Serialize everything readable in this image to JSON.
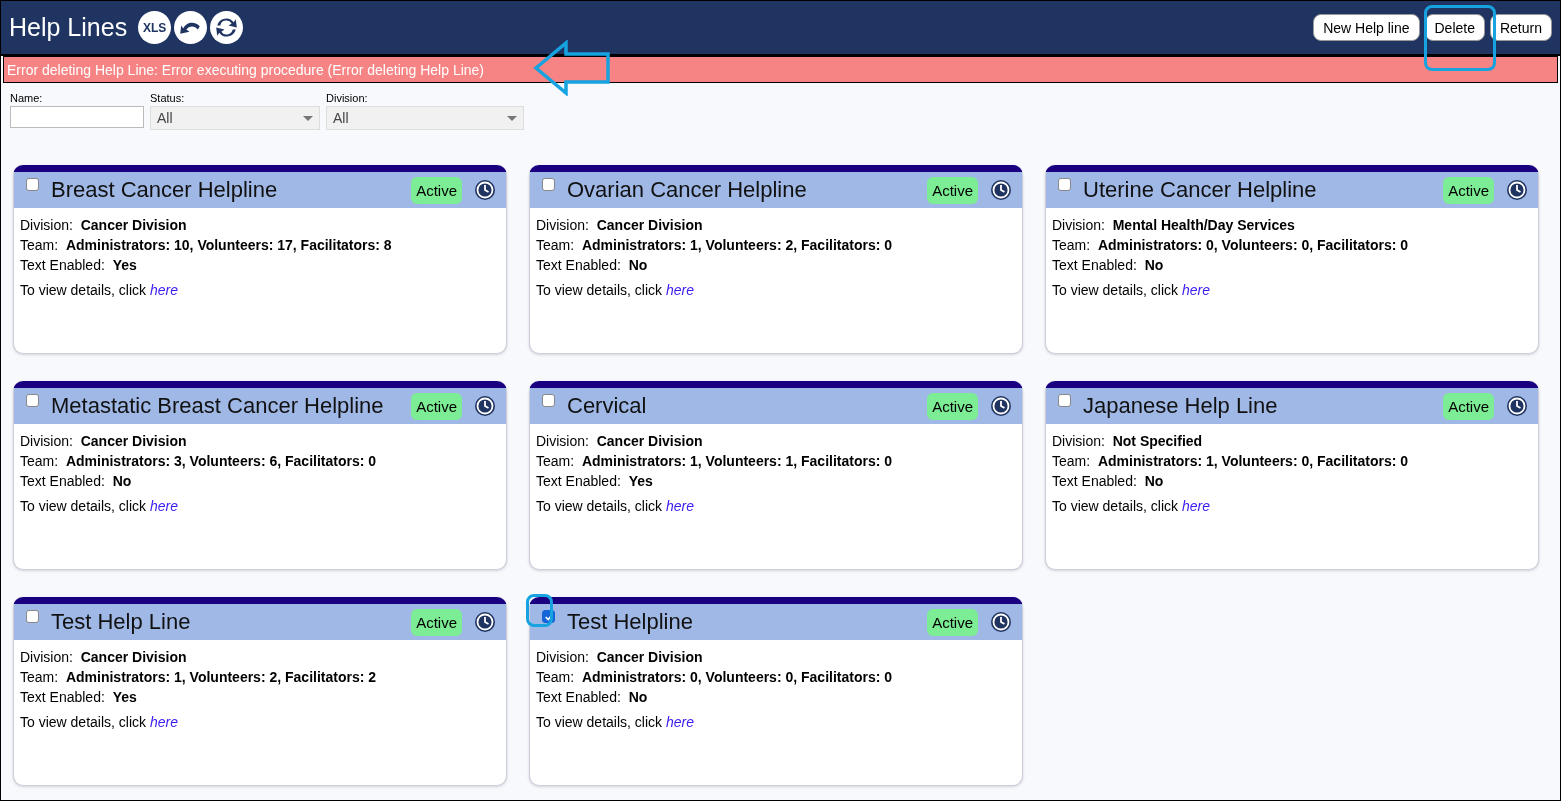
{
  "header": {
    "title": "Help Lines",
    "xls_label": "XLS",
    "buttons": [
      "New Help line",
      "Delete",
      "Return"
    ]
  },
  "error": "Error deleting Help Line: Error executing procedure (Error deleting Help Line)",
  "filters": [
    {
      "kind": "text",
      "label": "Name:"
    },
    {
      "kind": "select",
      "label": "Status:",
      "value": "All"
    },
    {
      "kind": "select",
      "label": "Division:",
      "value": "All"
    }
  ],
  "cards": [
    {
      "title": "Breast Cancer Helpline",
      "checked": false,
      "status": "Active",
      "division_label": "Division:",
      "division": "Cancer Division",
      "team_label": "Team:",
      "team": "Administrators: 10, Volunteers: 17, Facilitators: 8",
      "text_label": "Text Enabled:",
      "text_enabled": "Yes",
      "details": "To view details, click",
      "link": "here"
    },
    {
      "title": "Ovarian Cancer Helpline",
      "checked": false,
      "status": "Active",
      "division_label": "Division:",
      "division": "Cancer Division",
      "team_label": "Team:",
      "team": "Administrators: 1, Volunteers: 2, Facilitators: 0",
      "text_label": "Text Enabled:",
      "text_enabled": "No",
      "details": "To view details, click",
      "link": "here"
    },
    {
      "title": "Uterine Cancer Helpline",
      "checked": false,
      "status": "Active",
      "division_label": "Division:",
      "division": "Mental Health/Day Services",
      "team_label": "Team:",
      "team": "Administrators: 0, Volunteers: 0, Facilitators: 0",
      "text_label": "Text Enabled:",
      "text_enabled": "No",
      "details": "To view details, click",
      "link": "here"
    },
    {
      "title": "Metastatic Breast Cancer Helpline",
      "checked": false,
      "status": "Active",
      "division_label": "Division:",
      "division": "Cancer Division",
      "team_label": "Team:",
      "team": "Administrators: 3, Volunteers: 6, Facilitators: 0",
      "text_label": "Text Enabled:",
      "text_enabled": "No",
      "details": "To view details, click",
      "link": "here"
    },
    {
      "title": "Cervical",
      "checked": false,
      "status": "Active",
      "division_label": "Division:",
      "division": "Cancer Division",
      "team_label": "Team:",
      "team": "Administrators: 1, Volunteers: 1, Facilitators: 0",
      "text_label": "Text Enabled:",
      "text_enabled": "Yes",
      "details": "To view details, click",
      "link": "here"
    },
    {
      "title": "Japanese Help Line",
      "checked": false,
      "status": "Active",
      "division_label": "Division:",
      "division": "Not Specified",
      "team_label": "Team:",
      "team": "Administrators: 1, Volunteers: 0, Facilitators: 0",
      "text_label": "Text Enabled:",
      "text_enabled": "No",
      "details": "To view details, click",
      "link": "here"
    },
    {
      "title": "Test Help Line",
      "checked": false,
      "status": "Active",
      "division_label": "Division:",
      "division": "Cancer Division",
      "team_label": "Team:",
      "team": "Administrators: 1, Volunteers: 2, Facilitators: 2",
      "text_label": "Text Enabled:",
      "text_enabled": "Yes",
      "details": "To view details, click",
      "link": "here"
    },
    {
      "title": "Test Helpline",
      "checked": true,
      "status": "Active",
      "division_label": "Division:",
      "division": "Cancer Division",
      "team_label": "Team:",
      "team": "Administrators: 0, Volunteers: 0, Facilitators: 0",
      "text_label": "Text Enabled:",
      "text_enabled": "No",
      "details": "To view details, click",
      "link": "here"
    }
  ]
}
